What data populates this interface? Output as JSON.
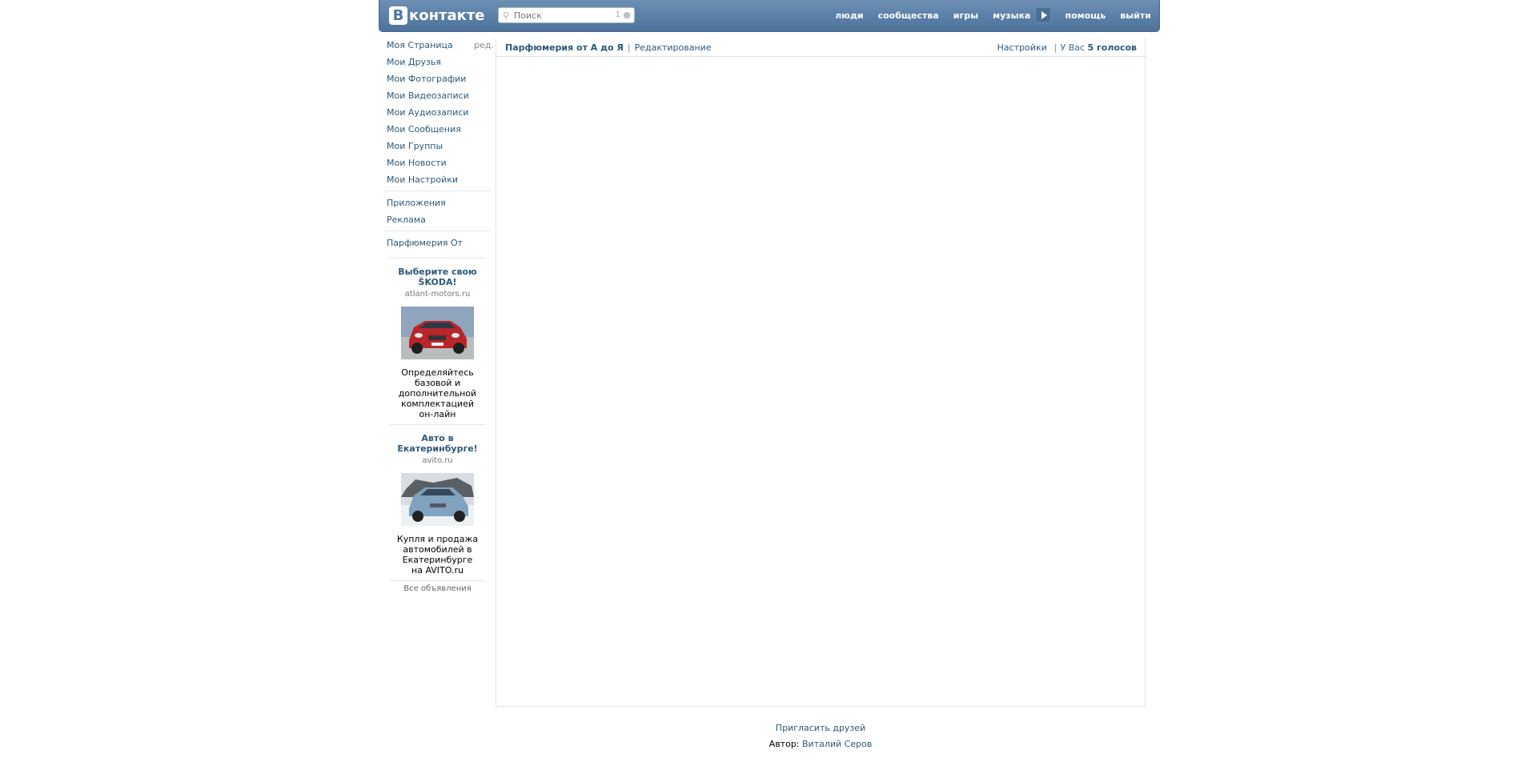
{
  "header": {
    "logo_letter": "В",
    "logo_text": "контакте",
    "search": {
      "placeholder": "Поиск",
      "count": "1"
    },
    "nav": [
      "люди",
      "сообщества",
      "игры",
      "музыка",
      "помощь",
      "выйти"
    ]
  },
  "sidebar": {
    "items": [
      {
        "label": "Моя Страница",
        "extra": "ред."
      },
      {
        "label": "Мои Друзья"
      },
      {
        "label": "Мои Фотографии"
      },
      {
        "label": "Мои Видеозаписи"
      },
      {
        "label": "Мои Аудиозаписи"
      },
      {
        "label": "Мои Сообщения"
      },
      {
        "label": "Мои Группы"
      },
      {
        "label": "Мои Новости"
      },
      {
        "label": "Мои Настройки"
      }
    ],
    "extras": [
      "Приложения",
      "Реклама"
    ],
    "app_link": "Парфюмерия От",
    "ads": [
      {
        "title": "Выберите свою ŠKODA!",
        "domain": "atlant-motors.ru",
        "desc": "Определяйтесь базовой и дополнительной комплектацией он-лайн"
      },
      {
        "title": "Авто в Екатеринбурге!",
        "domain": "avito.ru",
        "desc": "Купля и продажа автомобилей в Екатеринбурге на AVITO.ru"
      }
    ],
    "all_ads": "Все объявления"
  },
  "main": {
    "app_title": "Парфюмерия от А до Я",
    "edit_link": "Редактирование",
    "settings_link": "Настройки",
    "votes_prefix": "У Вас",
    "votes_value": "5 голосов"
  },
  "footer": {
    "invite": "Пригласить друзей",
    "author_label": "Автор:",
    "author_name": "Виталий Серов"
  }
}
